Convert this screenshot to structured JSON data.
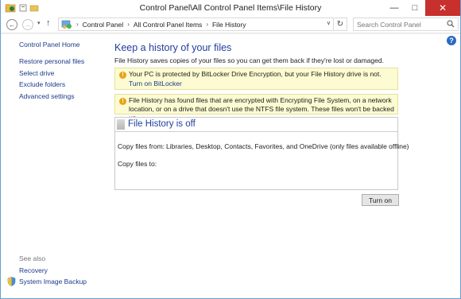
{
  "window": {
    "title": "Control Panel\\All Control Panel Items\\File History",
    "minimize": "—",
    "maximize": "□",
    "close": "✕"
  },
  "nav": {
    "back": "←",
    "forward": "→",
    "recent": "▾",
    "up": "↑",
    "breadcrumb": [
      "Control Panel",
      "All Control Panel Items",
      "File History"
    ],
    "separator": "›",
    "dropdown": "∨",
    "refresh": "↻",
    "search_placeholder": "Search Control Panel"
  },
  "sidebar": {
    "home": "Control Panel Home",
    "items": [
      {
        "label": "Restore personal files"
      },
      {
        "label": "Select drive"
      },
      {
        "label": "Exclude folders"
      },
      {
        "label": "Advanced settings"
      }
    ],
    "see_also": "See also",
    "see_also_items": [
      {
        "label": "Recovery"
      },
      {
        "label": "System Image Backup"
      }
    ]
  },
  "main": {
    "help": "?",
    "heading": "Keep a history of your files",
    "intro": "File History saves copies of your files so you can get them back if they're lost or damaged.",
    "notice1": {
      "text": "Your PC is protected by BitLocker Drive Encryption, but your File History drive is not.",
      "link": "Turn on BitLocker"
    },
    "notice2": {
      "text": "File History has found files that are encrypted with Encrypting File System, on a network location, or on a drive that doesn't use the NTFS file system. These files won't be backed up."
    },
    "status": {
      "title": "File History is off",
      "copy_from_label": "Copy files from:",
      "copy_from_value": "Libraries, Desktop, Contacts, Favorites, and OneDrive (only files available offline)",
      "copy_to_label": "Copy files to:"
    },
    "turn_on_button": "Turn on"
  },
  "colors": {
    "link": "#1a3a8a",
    "heading": "#1e3f9e",
    "notice_bg": "#fcfbd2",
    "close_btn": "#c7302d"
  }
}
